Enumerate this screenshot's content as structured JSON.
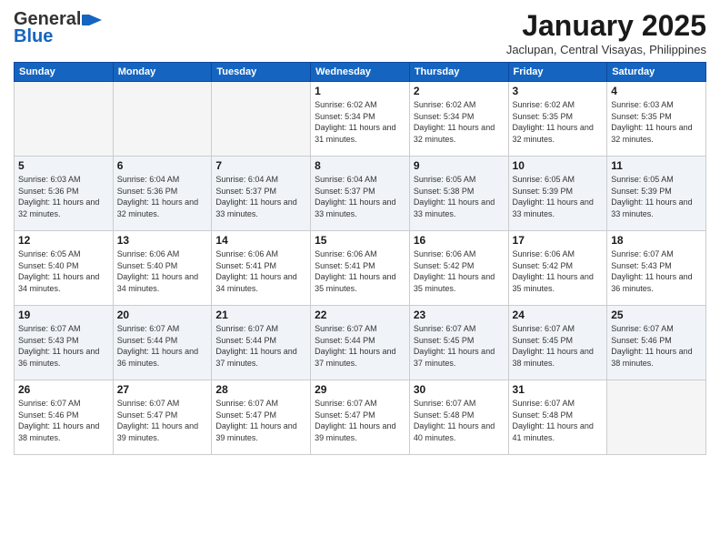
{
  "header": {
    "logo_general": "General",
    "logo_blue": "Blue",
    "month_title": "January 2025",
    "location": "Jaclupan, Central Visayas, Philippines"
  },
  "weekdays": [
    "Sunday",
    "Monday",
    "Tuesday",
    "Wednesday",
    "Thursday",
    "Friday",
    "Saturday"
  ],
  "weeks": [
    [
      {
        "day": "",
        "sunrise": "",
        "sunset": "",
        "daylight": "",
        "empty": true
      },
      {
        "day": "",
        "sunrise": "",
        "sunset": "",
        "daylight": "",
        "empty": true
      },
      {
        "day": "",
        "sunrise": "",
        "sunset": "",
        "daylight": "",
        "empty": true
      },
      {
        "day": "1",
        "sunrise": "6:02 AM",
        "sunset": "5:34 PM",
        "daylight": "11 hours and 31 minutes."
      },
      {
        "day": "2",
        "sunrise": "6:02 AM",
        "sunset": "5:34 PM",
        "daylight": "11 hours and 32 minutes."
      },
      {
        "day": "3",
        "sunrise": "6:02 AM",
        "sunset": "5:35 PM",
        "daylight": "11 hours and 32 minutes."
      },
      {
        "day": "4",
        "sunrise": "6:03 AM",
        "sunset": "5:35 PM",
        "daylight": "11 hours and 32 minutes."
      }
    ],
    [
      {
        "day": "5",
        "sunrise": "6:03 AM",
        "sunset": "5:36 PM",
        "daylight": "11 hours and 32 minutes."
      },
      {
        "day": "6",
        "sunrise": "6:04 AM",
        "sunset": "5:36 PM",
        "daylight": "11 hours and 32 minutes."
      },
      {
        "day": "7",
        "sunrise": "6:04 AM",
        "sunset": "5:37 PM",
        "daylight": "11 hours and 33 minutes."
      },
      {
        "day": "8",
        "sunrise": "6:04 AM",
        "sunset": "5:37 PM",
        "daylight": "11 hours and 33 minutes."
      },
      {
        "day": "9",
        "sunrise": "6:05 AM",
        "sunset": "5:38 PM",
        "daylight": "11 hours and 33 minutes."
      },
      {
        "day": "10",
        "sunrise": "6:05 AM",
        "sunset": "5:39 PM",
        "daylight": "11 hours and 33 minutes."
      },
      {
        "day": "11",
        "sunrise": "6:05 AM",
        "sunset": "5:39 PM",
        "daylight": "11 hours and 33 minutes."
      }
    ],
    [
      {
        "day": "12",
        "sunrise": "6:05 AM",
        "sunset": "5:40 PM",
        "daylight": "11 hours and 34 minutes."
      },
      {
        "day": "13",
        "sunrise": "6:06 AM",
        "sunset": "5:40 PM",
        "daylight": "11 hours and 34 minutes."
      },
      {
        "day": "14",
        "sunrise": "6:06 AM",
        "sunset": "5:41 PM",
        "daylight": "11 hours and 34 minutes."
      },
      {
        "day": "15",
        "sunrise": "6:06 AM",
        "sunset": "5:41 PM",
        "daylight": "11 hours and 35 minutes."
      },
      {
        "day": "16",
        "sunrise": "6:06 AM",
        "sunset": "5:42 PM",
        "daylight": "11 hours and 35 minutes."
      },
      {
        "day": "17",
        "sunrise": "6:06 AM",
        "sunset": "5:42 PM",
        "daylight": "11 hours and 35 minutes."
      },
      {
        "day": "18",
        "sunrise": "6:07 AM",
        "sunset": "5:43 PM",
        "daylight": "11 hours and 36 minutes."
      }
    ],
    [
      {
        "day": "19",
        "sunrise": "6:07 AM",
        "sunset": "5:43 PM",
        "daylight": "11 hours and 36 minutes."
      },
      {
        "day": "20",
        "sunrise": "6:07 AM",
        "sunset": "5:44 PM",
        "daylight": "11 hours and 36 minutes."
      },
      {
        "day": "21",
        "sunrise": "6:07 AM",
        "sunset": "5:44 PM",
        "daylight": "11 hours and 37 minutes."
      },
      {
        "day": "22",
        "sunrise": "6:07 AM",
        "sunset": "5:44 PM",
        "daylight": "11 hours and 37 minutes."
      },
      {
        "day": "23",
        "sunrise": "6:07 AM",
        "sunset": "5:45 PM",
        "daylight": "11 hours and 37 minutes."
      },
      {
        "day": "24",
        "sunrise": "6:07 AM",
        "sunset": "5:45 PM",
        "daylight": "11 hours and 38 minutes."
      },
      {
        "day": "25",
        "sunrise": "6:07 AM",
        "sunset": "5:46 PM",
        "daylight": "11 hours and 38 minutes."
      }
    ],
    [
      {
        "day": "26",
        "sunrise": "6:07 AM",
        "sunset": "5:46 PM",
        "daylight": "11 hours and 38 minutes."
      },
      {
        "day": "27",
        "sunrise": "6:07 AM",
        "sunset": "5:47 PM",
        "daylight": "11 hours and 39 minutes."
      },
      {
        "day": "28",
        "sunrise": "6:07 AM",
        "sunset": "5:47 PM",
        "daylight": "11 hours and 39 minutes."
      },
      {
        "day": "29",
        "sunrise": "6:07 AM",
        "sunset": "5:47 PM",
        "daylight": "11 hours and 39 minutes."
      },
      {
        "day": "30",
        "sunrise": "6:07 AM",
        "sunset": "5:48 PM",
        "daylight": "11 hours and 40 minutes."
      },
      {
        "day": "31",
        "sunrise": "6:07 AM",
        "sunset": "5:48 PM",
        "daylight": "11 hours and 41 minutes."
      },
      {
        "day": "",
        "sunrise": "",
        "sunset": "",
        "daylight": "",
        "empty": true
      }
    ]
  ]
}
